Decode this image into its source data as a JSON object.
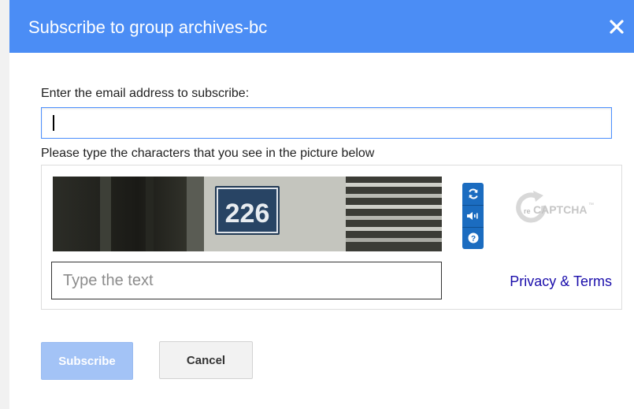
{
  "dialog": {
    "title": "Subscribe to group archives-bc",
    "close_icon": "close-icon",
    "header_color": "#4b8df5"
  },
  "email": {
    "label": "Enter the email address to subscribe:",
    "value": "",
    "placeholder": ""
  },
  "captcha": {
    "instructions": "Please type the characters that you see in the picture below",
    "image_text": "226",
    "input_placeholder": "Type the text",
    "input_value": "",
    "controls": [
      {
        "name": "refresh-icon",
        "label": "Get a new challenge"
      },
      {
        "name": "audio-icon",
        "label": "Get an audio challenge"
      },
      {
        "name": "help-icon",
        "label": "Help"
      }
    ],
    "logo_prefix": "re",
    "logo_text": "CAPTCHA",
    "logo_tm": "™",
    "privacy_link": "Privacy & Terms"
  },
  "buttons": {
    "subscribe": "Subscribe",
    "cancel": "Cancel"
  }
}
